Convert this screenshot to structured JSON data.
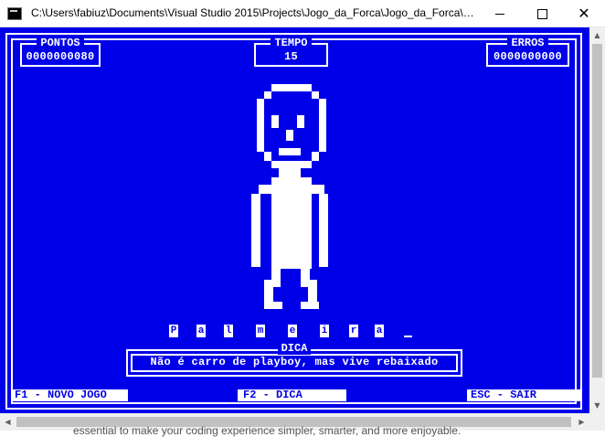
{
  "window": {
    "title": "C:\\Users\\fabiuz\\Documents\\Visual Studio 2015\\Projects\\Jogo_da_Forca\\Jogo_da_Forca\\bi...",
    "minimize_glyph": "",
    "close_glyph": "✕"
  },
  "scores": {
    "pontos_label": "PONTOS",
    "pontos_value": "0000000080",
    "tempo_label": "TEMPO",
    "tempo_value": "15",
    "erros_label": "ERROS",
    "erros_value": "0000000000"
  },
  "word": {
    "letters": [
      "P",
      "a",
      "l",
      "m",
      "e",
      "i",
      "r",
      "a"
    ],
    "remaining_blanks": 1
  },
  "hint": {
    "label": "DICA",
    "text": "Não é carro de playboy, mas vive rebaixado"
  },
  "menu": {
    "f1": "F1 - NOVO JOGO",
    "f2": "F2 - DICA",
    "esc": "ESC - SAIR"
  },
  "background_text": "essential to make your coding experience simpler, smarter, and more enjoyable.",
  "colors": {
    "console_bg": "#0000e8",
    "foreground": "#ffffff"
  },
  "icons": {
    "scroll_up": "▲",
    "scroll_down": "▼",
    "scroll_left": "◀",
    "scroll_right": "▶"
  }
}
